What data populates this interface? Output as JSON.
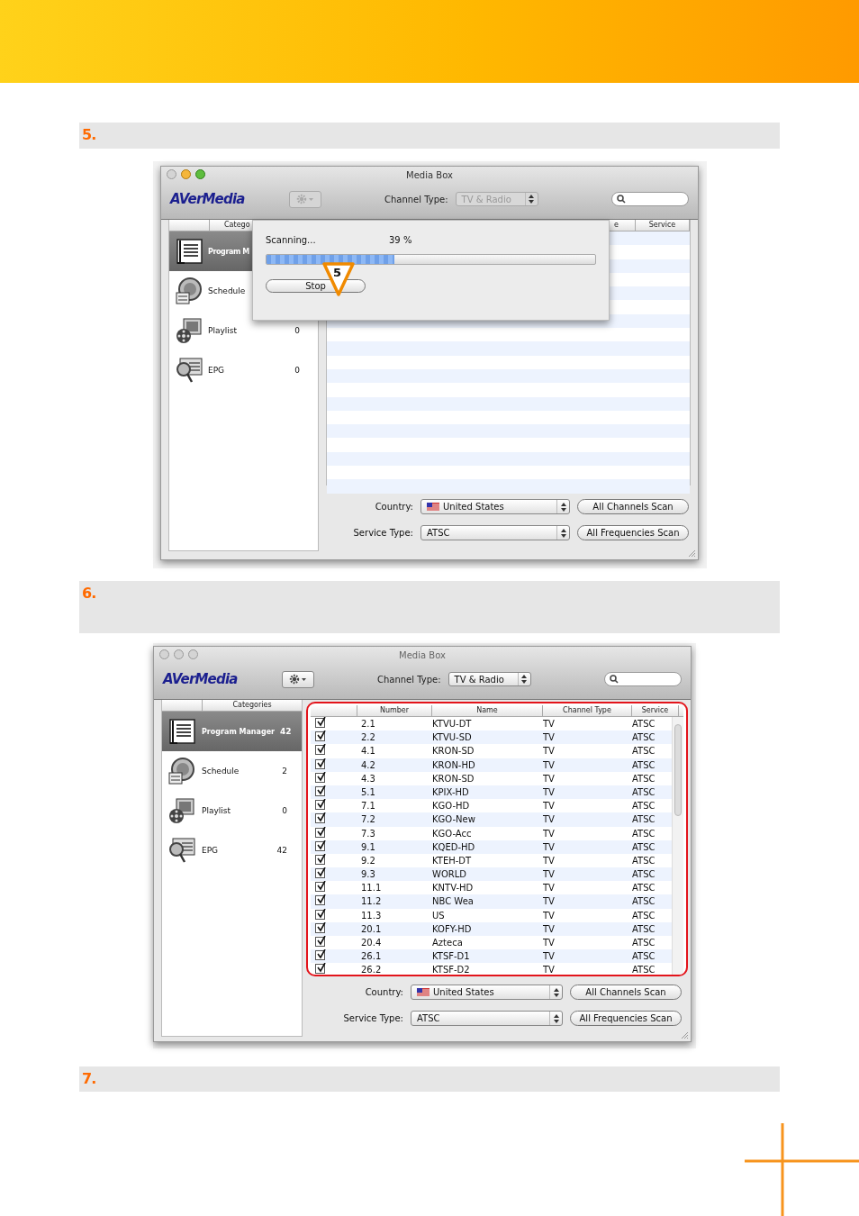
{
  "steps": [
    {
      "label": "5.",
      "window": {
        "title": "Media Box",
        "focused": true,
        "logo": "AVerMedia",
        "controls_disabled": true,
        "channel_type": {
          "label": "Channel Type:",
          "value": "TV & Radio"
        },
        "sidebar": {
          "header": "Catego",
          "items": [
            {
              "label": "Program M",
              "selected": true
            },
            {
              "label": "Schedule",
              "selected": false
            },
            {
              "label": "Playlist",
              "count": "0",
              "selected": false
            },
            {
              "label": "EPG",
              "count": "0",
              "selected": false
            }
          ]
        },
        "table": {
          "columns": [
            "e",
            "Service"
          ]
        },
        "scan_sheet": {
          "status": "Scanning...",
          "percent": "39 %",
          "level": 0.39,
          "button": "Stop",
          "callout": "5"
        },
        "highlighted": false,
        "country": {
          "label": "Country:",
          "value": "United States"
        },
        "service_type": {
          "label": "Service Type:",
          "value": "ATSC"
        },
        "buttons": [
          "All Channels Scan",
          "All Frequencies Scan"
        ]
      }
    },
    {
      "label": "6.",
      "window": {
        "title": "Media Box",
        "focused": false,
        "logo": "AVerMedia",
        "controls_disabled": false,
        "channel_type": {
          "label": "Channel Type:",
          "value": "TV & Radio"
        },
        "sidebar": {
          "header": "Categories",
          "items": [
            {
              "label": "Program Manager",
              "count": "42",
              "selected": true
            },
            {
              "label": "Schedule",
              "count": "2",
              "selected": false
            },
            {
              "label": "Playlist",
              "count": "0",
              "selected": false
            },
            {
              "label": "EPG",
              "count": "42",
              "selected": false
            }
          ]
        },
        "table": {
          "columns": [
            "Number",
            "Name",
            "Channel Type",
            "Service"
          ],
          "rows": [
            {
              "checked": true,
              "cells": [
                "2.1",
                "KTVU-DT",
                "TV",
                "ATSC"
              ]
            },
            {
              "checked": true,
              "cells": [
                "2.2",
                "KTVU-SD",
                "TV",
                "ATSC"
              ]
            },
            {
              "checked": true,
              "cells": [
                "4.1",
                "KRON-SD",
                "TV",
                "ATSC"
              ]
            },
            {
              "checked": true,
              "cells": [
                "4.2",
                "KRON-HD",
                "TV",
                "ATSC"
              ]
            },
            {
              "checked": true,
              "cells": [
                "4.3",
                "KRON-SD",
                "TV",
                "ATSC"
              ]
            },
            {
              "checked": true,
              "cells": [
                "5.1",
                "KPIX-HD",
                "TV",
                "ATSC"
              ]
            },
            {
              "checked": true,
              "cells": [
                "7.1",
                "KGO-HD",
                "TV",
                "ATSC"
              ]
            },
            {
              "checked": true,
              "cells": [
                "7.2",
                "KGO-New",
                "TV",
                "ATSC"
              ]
            },
            {
              "checked": true,
              "cells": [
                "7.3",
                "KGO-Acc",
                "TV",
                "ATSC"
              ]
            },
            {
              "checked": true,
              "cells": [
                "9.1",
                "KQED-HD",
                "TV",
                "ATSC"
              ]
            },
            {
              "checked": true,
              "cells": [
                "9.2",
                "KTEH-DT",
                "TV",
                "ATSC"
              ]
            },
            {
              "checked": true,
              "cells": [
                "9.3",
                "WORLD",
                "TV",
                "ATSC"
              ]
            },
            {
              "checked": true,
              "cells": [
                "11.1",
                "KNTV-HD",
                "TV",
                "ATSC"
              ]
            },
            {
              "checked": true,
              "cells": [
                "11.2",
                "NBC Wea",
                "TV",
                "ATSC"
              ]
            },
            {
              "checked": true,
              "cells": [
                "11.3",
                "US",
                "TV",
                "ATSC"
              ]
            },
            {
              "checked": true,
              "cells": [
                "20.1",
                "KOFY-HD",
                "TV",
                "ATSC"
              ]
            },
            {
              "checked": true,
              "cells": [
                "20.4",
                "Azteca",
                "TV",
                "ATSC"
              ]
            },
            {
              "checked": true,
              "cells": [
                "26.1",
                "KTSF-D1",
                "TV",
                "ATSC"
              ]
            },
            {
              "checked": true,
              "cells": [
                "26.2",
                "KTSF-D2",
                "TV",
                "ATSC"
              ]
            }
          ]
        },
        "highlighted": true,
        "country": {
          "label": "Country:",
          "value": "United States"
        },
        "service_type": {
          "label": "Service Type:",
          "value": "ATSC"
        },
        "buttons": [
          "All Channels Scan",
          "All Frequencies Scan"
        ]
      }
    },
    {
      "label": "7."
    }
  ]
}
